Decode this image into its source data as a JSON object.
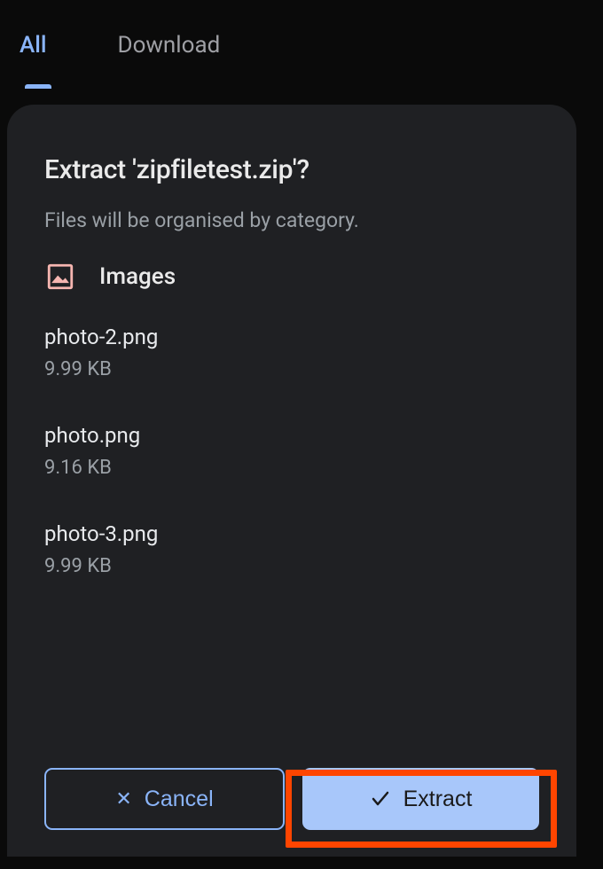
{
  "tabs": {
    "all": "All",
    "download": "Download"
  },
  "dialog": {
    "title": "Extract 'zipfiletest.zip'?",
    "subtitle": "Files will be organised by category.",
    "category_label": "Images",
    "files": [
      {
        "name": "photo-2.png",
        "size": "9.99 KB"
      },
      {
        "name": "photo.png",
        "size": "9.16 KB"
      },
      {
        "name": "photo-3.png",
        "size": "9.99 KB"
      }
    ],
    "cancel_label": "Cancel",
    "extract_label": "Extract"
  }
}
